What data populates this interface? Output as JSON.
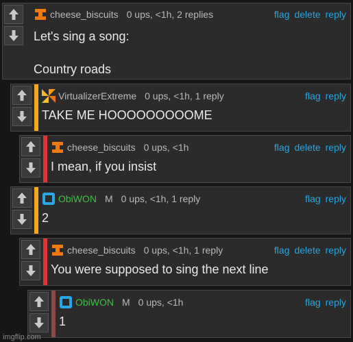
{
  "actions": {
    "flag": "flag",
    "delete": "delete",
    "reply": "reply"
  },
  "comments": [
    {
      "user": "cheese_biscuits",
      "badge": "",
      "meta": "0 ups, <1h, 2 replies",
      "lines": [
        "Let's sing a song:",
        "",
        "Country roads"
      ],
      "has_delete": true,
      "avatar": "orange-i-icon",
      "bar_color": "#e86a10"
    },
    {
      "user": "VirtualizerExtreme",
      "badge": "",
      "meta": "0 ups, <1h, 1 reply",
      "lines": [
        "TAKE ME HOOOOOOOOOME"
      ],
      "has_delete": false,
      "avatar": "pinwheel-icon",
      "bar_color": "#f5a623"
    },
    {
      "user": "cheese_biscuits",
      "badge": "",
      "meta": "0 ups, <1h",
      "lines": [
        "I mean, if you insist"
      ],
      "has_delete": true,
      "avatar": "orange-i-icon",
      "bar_color": "#e03434"
    },
    {
      "user": "ObiWON",
      "badge": "M",
      "meta": "0 ups, <1h, 1 reply",
      "lines": [
        "2"
      ],
      "has_delete": false,
      "avatar": "blue-frame-icon",
      "bar_color": "#f5a623"
    },
    {
      "user": "cheese_biscuits",
      "badge": "",
      "meta": "0 ups, <1h, 1 reply",
      "lines": [
        "You were supposed to sing the next line"
      ],
      "has_delete": true,
      "avatar": "orange-i-icon",
      "bar_color": "#e03434"
    },
    {
      "user": "ObiWON",
      "badge": "M",
      "meta": "0 ups, <1h",
      "lines": [
        "1"
      ],
      "has_delete": false,
      "avatar": "blue-frame-icon",
      "bar_color": "#8a4a4a"
    }
  ],
  "watermark": "imgflip.com"
}
